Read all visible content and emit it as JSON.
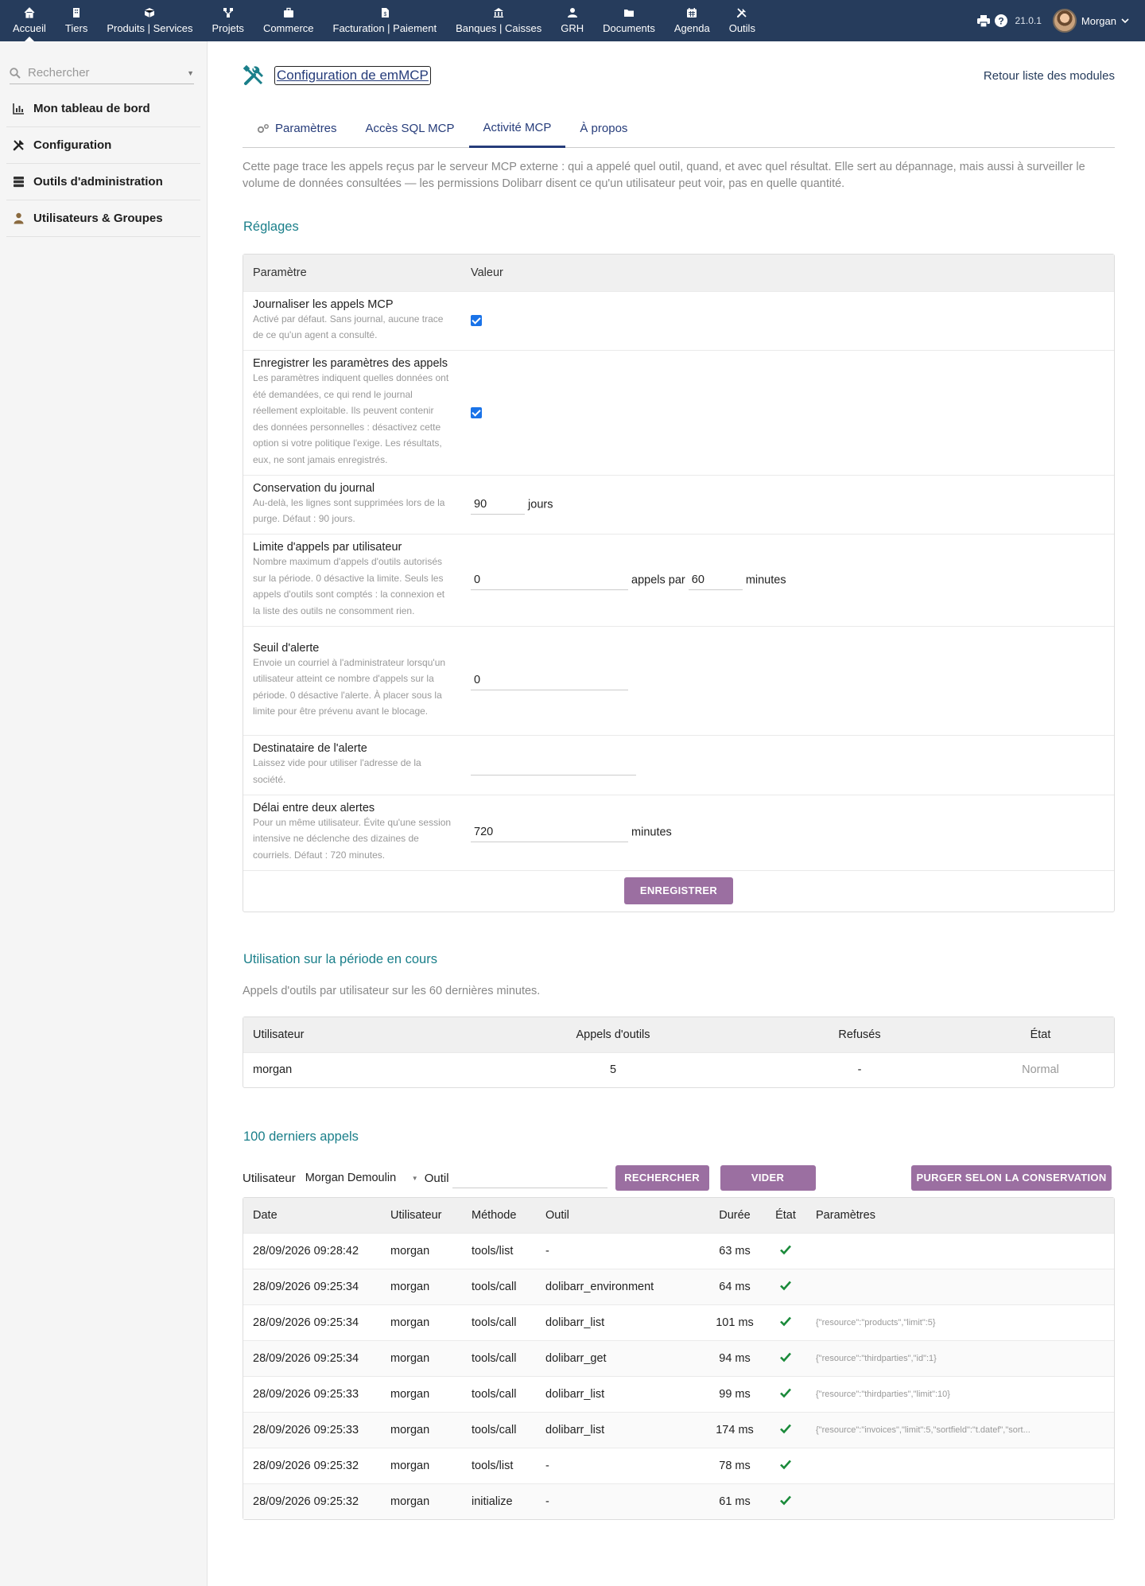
{
  "topmenu": [
    {
      "label": "Accueil",
      "icon": "home-icon"
    },
    {
      "label": "Tiers",
      "icon": "building-icon"
    },
    {
      "label": "Produits | Services",
      "icon": "cube-icon"
    },
    {
      "label": "Projets",
      "icon": "project-icon"
    },
    {
      "label": "Commerce",
      "icon": "briefcase-icon"
    },
    {
      "label": "Facturation | Paiement",
      "icon": "invoice-icon"
    },
    {
      "label": "Banques | Caisses",
      "icon": "bank-icon"
    },
    {
      "label": "GRH",
      "icon": "user-icon"
    },
    {
      "label": "Documents",
      "icon": "folder-icon"
    },
    {
      "label": "Agenda",
      "icon": "calendar-icon"
    },
    {
      "label": "Outils",
      "icon": "tools-icon"
    }
  ],
  "topright": {
    "version": "21.0.1",
    "user": "Morgan"
  },
  "sidebar": {
    "search_placeholder": "Rechercher",
    "items": [
      {
        "label": "Mon tableau de bord",
        "icon": "chart-icon"
      },
      {
        "label": "Configuration",
        "icon": "tools-icon"
      },
      {
        "label": "Outils d'administration",
        "icon": "server-icon"
      },
      {
        "label": "Utilisateurs & Groupes",
        "icon": "user-icon"
      }
    ]
  },
  "page": {
    "title": "Configuration de emMCP",
    "back_link": "Retour liste des modules",
    "tabs": [
      "Paramètres",
      "Accès SQL MCP",
      "Activité MCP",
      "À propos"
    ],
    "active_tab": "Activité MCP",
    "intro": "Cette page trace les appels reçus par le serveur MCP externe : qui a appelé quel outil, quand, et avec quel résultat. Elle sert au dépannage, mais aussi à surveiller le volume de données consultées — les permissions Dolibarr disent ce qu'un utilisateur peut voir, pas en quelle quantité."
  },
  "settings": {
    "heading": "Réglages",
    "col_param": "Paramètre",
    "col_value": "Valeur",
    "log_calls": {
      "title": "Journaliser les appels MCP",
      "desc": "Activé par défaut. Sans journal, aucune trace de ce qu'un agent a consulté.",
      "checked": true
    },
    "log_params": {
      "title": "Enregistrer les paramètres des appels",
      "desc": "Les paramètres indiquent quelles données ont été demandées, ce qui rend le journal réellement exploitable. Ils peuvent contenir des données personnelles : désactivez cette option si votre politique l'exige. Les résultats, eux, ne sont jamais enregistrés.",
      "checked": true
    },
    "retention": {
      "title": "Conservation du journal",
      "desc": "Au-delà, les lignes sont supprimées lors de la purge. Défaut : 90 jours.",
      "value": "90",
      "unit": "jours"
    },
    "rate_limit": {
      "title": "Limite d'appels par utilisateur",
      "desc": "Nombre maximum d'appels d'outils autorisés sur la période. 0 désactive la limite. Seuls les appels d'outils sont comptés : la connexion et la liste des outils ne consomment rien.",
      "value": "0",
      "mid": "appels par",
      "period": "60",
      "unit": "minutes"
    },
    "alert_threshold": {
      "title": "Seuil d'alerte",
      "desc": "Envoie un courriel à l'administrateur lorsqu'un utilisateur atteint ce nombre d'appels sur la période. 0 désactive l'alerte. À placer sous la limite pour être prévenu avant le blocage.",
      "value": "0"
    },
    "alert_recipient": {
      "title": "Destinataire de l'alerte",
      "desc": "Laissez vide pour utiliser l'adresse de la société.",
      "value": ""
    },
    "alert_delay": {
      "title": "Délai entre deux alertes",
      "desc": "Pour un même utilisateur. Évite qu'une session intensive ne déclenche des dizaines de courriels. Défaut : 720 minutes.",
      "value": "720",
      "unit": "minutes"
    },
    "save_label": "ENREGISTRER"
  },
  "usage": {
    "heading": "Utilisation sur la période en cours",
    "note": "Appels d'outils par utilisateur sur les 60 dernières minutes.",
    "columns": [
      "Utilisateur",
      "Appels d'outils",
      "Refusés",
      "État"
    ],
    "rows": [
      [
        "morgan",
        "5",
        "-",
        "Normal"
      ]
    ]
  },
  "calls": {
    "heading": "100 derniers appels",
    "filter_user_label": "Utilisateur",
    "filter_user_value": "Morgan Demoulin",
    "filter_tool_label": "Outil",
    "filter_tool_value": "",
    "search_btn": "RECHERCHER",
    "clear_btn": "VIDER",
    "purge_btn": "PURGER SELON LA CONSERVATION",
    "columns": [
      "Date",
      "Utilisateur",
      "Méthode",
      "Outil",
      "Durée",
      "État",
      "Paramètres"
    ],
    "rows": [
      {
        "date": "28/09/2026 09:28:42",
        "user": "morgan",
        "method": "tools/list",
        "tool": "-",
        "duration": "63 ms",
        "params": ""
      },
      {
        "date": "28/09/2026 09:25:34",
        "user": "morgan",
        "method": "tools/call",
        "tool": "dolibarr_environment",
        "duration": "64 ms",
        "params": ""
      },
      {
        "date": "28/09/2026 09:25:34",
        "user": "morgan",
        "method": "tools/call",
        "tool": "dolibarr_list",
        "duration": "101 ms",
        "params": "{\"resource\":\"products\",\"limit\":5}"
      },
      {
        "date": "28/09/2026 09:25:34",
        "user": "morgan",
        "method": "tools/call",
        "tool": "dolibarr_get",
        "duration": "94 ms",
        "params": "{\"resource\":\"thirdparties\",\"id\":1}"
      },
      {
        "date": "28/09/2026 09:25:33",
        "user": "morgan",
        "method": "tools/call",
        "tool": "dolibarr_list",
        "duration": "99 ms",
        "params": "{\"resource\":\"thirdparties\",\"limit\":10}"
      },
      {
        "date": "28/09/2026 09:25:33",
        "user": "morgan",
        "method": "tools/call",
        "tool": "dolibarr_list",
        "duration": "174 ms",
        "params": "{\"resource\":\"invoices\",\"limit\":5,\"sortfield\":\"t.datef\",\"sort..."
      },
      {
        "date": "28/09/2026 09:25:32",
        "user": "morgan",
        "method": "tools/list",
        "tool": "-",
        "duration": "78 ms",
        "params": ""
      },
      {
        "date": "28/09/2026 09:25:32",
        "user": "morgan",
        "method": "initialize",
        "tool": "-",
        "duration": "61 ms",
        "params": ""
      }
    ]
  },
  "colors": {
    "topbar": "#263c5c",
    "accent": "#1a7f8a",
    "button": "#9b6fa1",
    "ok": "#1a8a3a"
  }
}
